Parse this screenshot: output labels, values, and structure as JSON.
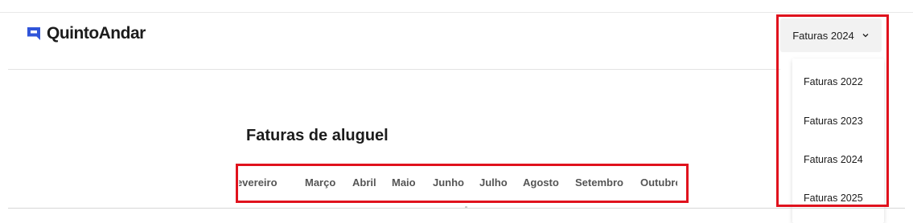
{
  "brand": {
    "name": "QuintoAndar",
    "accent_color": "#3055d9",
    "logo_icon": "quintoandar-logo-icon"
  },
  "year_select": {
    "selected": "Faturas 2024",
    "icon": "chevron-down-icon"
  },
  "year_dropdown": {
    "options": [
      "Faturas 2022",
      "Faturas 2023",
      "Faturas 2024",
      "Faturas 2025"
    ]
  },
  "page": {
    "title": "Faturas de aluguel"
  },
  "month_tabs": {
    "items": [
      "Fevereiro",
      "Março",
      "Abril",
      "Maio",
      "Junho",
      "Julho",
      "Agosto",
      "Setembro",
      "Outubro"
    ]
  },
  "annotations": {
    "highlight_color": "#e0121d"
  }
}
